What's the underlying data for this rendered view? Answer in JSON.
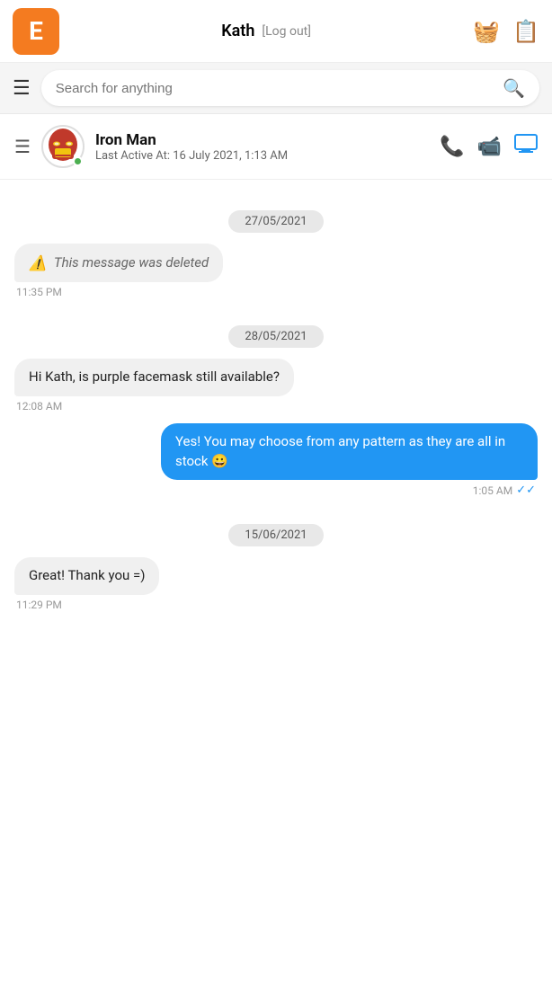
{
  "header": {
    "logo_letter": "E",
    "username": "Kath",
    "logout_label": "[Log out]",
    "basket_icon": "🧺",
    "doc_icon": "📄"
  },
  "search": {
    "placeholder": "Search for anything"
  },
  "chat_header": {
    "contact_name": "Iron Man",
    "last_active": "Last Active At: 16 July 2021, 1:13 AM",
    "avatar_emoji": "🤖",
    "phone_icon": "📞",
    "video_icon": "📹",
    "screen_icon": "🖥"
  },
  "messages": [
    {
      "type": "date",
      "value": "27/05/2021"
    },
    {
      "type": "received",
      "deleted": true,
      "text": "This message was deleted",
      "time": "11:35 PM"
    },
    {
      "type": "date",
      "value": "28/05/2021"
    },
    {
      "type": "received",
      "text": "Hi Kath, is purple facemask still available?",
      "time": "12:08 AM"
    },
    {
      "type": "sent",
      "text": "Yes! You may choose from any pattern as they are all in stock 😀",
      "time": "1:05 AM",
      "read": true
    },
    {
      "type": "date",
      "value": "15/06/2021"
    },
    {
      "type": "received",
      "text": "Great! Thank you =)",
      "time": "11:29 PM"
    }
  ]
}
